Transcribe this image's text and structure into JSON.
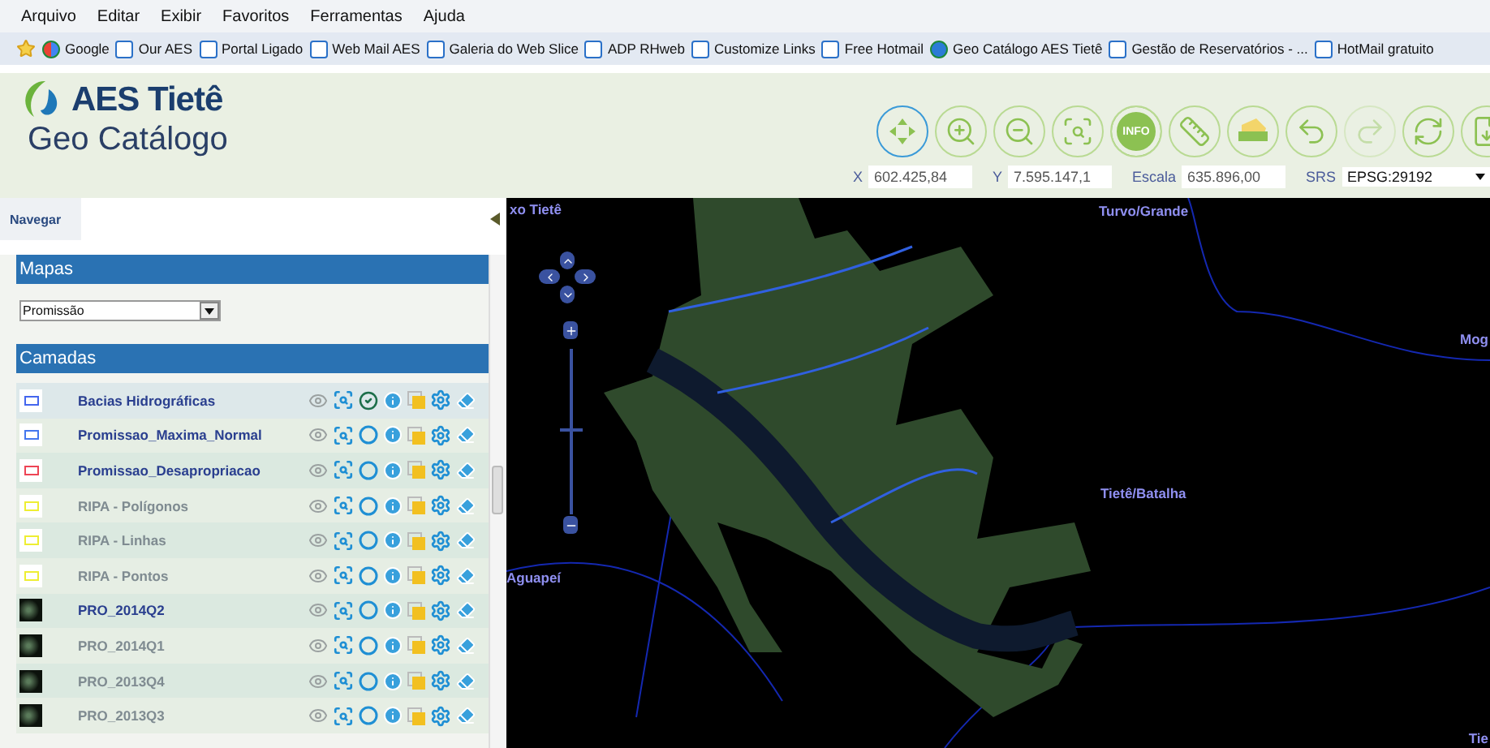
{
  "menu_bar": [
    "Arquivo",
    "Editar",
    "Exibir",
    "Favoritos",
    "Ferramentas",
    "Ajuda"
  ],
  "favorites": [
    {
      "label": "Google",
      "kind": "google"
    },
    {
      "label": "Our AES",
      "kind": "page"
    },
    {
      "label": "Portal Ligado",
      "kind": "page"
    },
    {
      "label": "Web Mail AES",
      "kind": "page"
    },
    {
      "label": "Galeria do Web Slice",
      "kind": "page"
    },
    {
      "label": "ADP RHweb",
      "kind": "page"
    },
    {
      "label": "Customize Links",
      "kind": "page"
    },
    {
      "label": "Free Hotmail",
      "kind": "page"
    },
    {
      "label": "Geo Catálogo AES Tietê",
      "kind": "globe"
    },
    {
      "label": "Gestão de Reservatórios - ...",
      "kind": "page"
    },
    {
      "label": "HotMail gratuito",
      "kind": "page"
    }
  ],
  "logo": {
    "brand": "AES Tietê",
    "subtitle": "Geo Catálogo"
  },
  "toolbar": [
    {
      "kind": "pan",
      "selected": true,
      "disabled": false
    },
    {
      "kind": "zoom_in",
      "selected": false,
      "disabled": false
    },
    {
      "kind": "zoom_out",
      "selected": false,
      "disabled": false
    },
    {
      "kind": "zoom_box",
      "selected": false,
      "disabled": false
    },
    {
      "kind": "info",
      "label": "INFO",
      "selected": false,
      "disabled": false
    },
    {
      "kind": "measure",
      "selected": false,
      "disabled": false
    },
    {
      "kind": "area",
      "selected": false,
      "disabled": false
    },
    {
      "kind": "undo",
      "selected": false,
      "disabled": false
    },
    {
      "kind": "redo",
      "selected": false,
      "disabled": true
    },
    {
      "kind": "refresh",
      "selected": false,
      "disabled": false
    },
    {
      "kind": "export",
      "selected": false,
      "disabled": false
    }
  ],
  "coordinates": [
    {
      "label": "X",
      "value": "602.425,84"
    },
    {
      "label": "Y",
      "value": "7.595.147,1"
    },
    {
      "label": "Escala",
      "value": "635.896,00"
    }
  ],
  "srs": {
    "label": "SRS",
    "value": "EPSG:29192"
  },
  "navegar": {
    "label": "Navegar"
  },
  "mapas": {
    "title": "Mapas",
    "select": "Promissão"
  },
  "camadas": {
    "title": "Camadas",
    "layers": [
      {
        "name": "Bacias Hidrográficas",
        "kind": "outline",
        "color": "#4466ee",
        "active": true,
        "selected": true
      },
      {
        "name": "Promissao_Maxima_Normal",
        "kind": "outline",
        "color": "#4477ee",
        "active": true,
        "selected": false
      },
      {
        "name": "Promissao_Desapropriacao",
        "kind": "outline",
        "color": "#ee4455",
        "active": true,
        "selected": false
      },
      {
        "name": "RIPA - Polígonos",
        "kind": "outline",
        "color": "#eeee33",
        "active": false,
        "selected": false
      },
      {
        "name": "RIPA - Linhas",
        "kind": "outline",
        "color": "#eeee33",
        "active": false,
        "selected": false
      },
      {
        "name": "RIPA - Pontos",
        "kind": "outline",
        "color": "#eeee33",
        "active": false,
        "selected": false
      },
      {
        "name": "PRO_2014Q2",
        "kind": "raster",
        "active": true,
        "selected": false
      },
      {
        "name": "PRO_2014Q1",
        "kind": "raster",
        "active": false,
        "selected": false
      },
      {
        "name": "PRO_2013Q4",
        "kind": "raster",
        "active": false,
        "selected": false
      },
      {
        "name": "PRO_2013Q3",
        "kind": "raster",
        "active": false,
        "selected": false
      }
    ]
  },
  "map": {
    "labels": [
      {
        "text": "xo Tietê",
        "kind": "top_left"
      },
      {
        "text": "Turvo/Grande",
        "kind": "top_mid"
      },
      {
        "text": "Mog",
        "kind": "right"
      },
      {
        "text": "Tietê/Batalha",
        "kind": "mid"
      },
      {
        "text": "Aguapeí",
        "kind": "left"
      },
      {
        "text": "Tie",
        "kind": "bottom_right"
      }
    ],
    "zoom": {
      "level": 0.52
    }
  }
}
